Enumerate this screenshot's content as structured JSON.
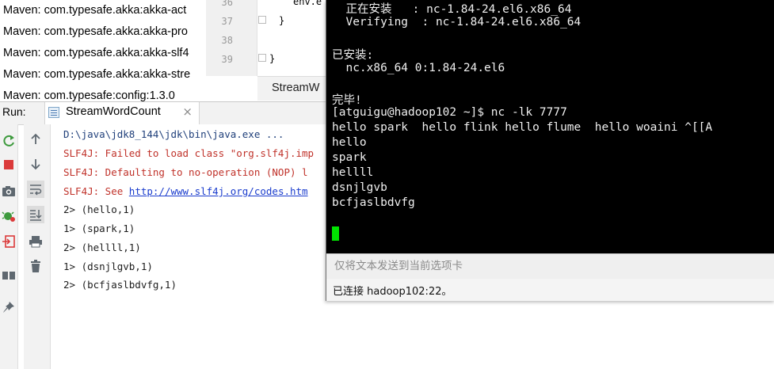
{
  "maven": {
    "items": [
      "Maven: com.typesafe.akka:akka-act",
      "Maven: com.typesafe.akka:akka-pro",
      "Maven: com.typesafe.akka:akka-slf4",
      "Maven: com.typesafe.akka:akka-stre",
      "Maven: com.typesafe:config:1.3.0"
    ]
  },
  "editor": {
    "line_numbers": [
      "36",
      "37",
      "38",
      "39"
    ],
    "code": [
      "env.e",
      "}",
      "",
      "}"
    ],
    "tab_label": "StreamW"
  },
  "run_panel": {
    "label": "Run:",
    "tab_label": "StreamWordCount",
    "tab_close": "×"
  },
  "console": {
    "cmd": "D:\\java\\jdk8_144\\jdk\\bin\\java.exe ...",
    "err1": "SLF4J: Failed to load class \"org.slf4j.imp",
    "err2": "SLF4J: Defaulting to no-operation (NOP) l",
    "err3_prefix": "SLF4J: See ",
    "err3_link": "http://www.slf4j.org/codes.htm",
    "outputs": [
      "2> (hello,1)",
      "1> (spark,1)",
      "2> (hellll,1)",
      "1> (dsnjlgvb,1)",
      "2> (bcfjaslbdvfg,1)"
    ]
  },
  "terminal": {
    "lines": [
      "  正在安装   : nc-1.84-24.el6.x86_64",
      "  Verifying  : nc-1.84-24.el6.x86_64",
      "",
      "已安装:",
      "  nc.x86_64 0:1.84-24.el6",
      "",
      "完毕!",
      "[atguigu@hadoop102 ~]$ nc -lk 7777",
      "hello spark  hello flink hello flume  hello woaini ^[[A",
      "hello",
      "spark",
      "hellll",
      "dsnjlgvb",
      "bcfjaslbdvfg"
    ],
    "compose_placeholder": "仅将文本发送到当前选项卡",
    "status": "已连接 hadoop102:22。"
  },
  "colors": {
    "terminal_bg": "#000000",
    "terminal_fg": "#f0f0f0",
    "cursor": "#00e400",
    "console_error": "#c0322a",
    "console_link": "#1a3ccd"
  }
}
